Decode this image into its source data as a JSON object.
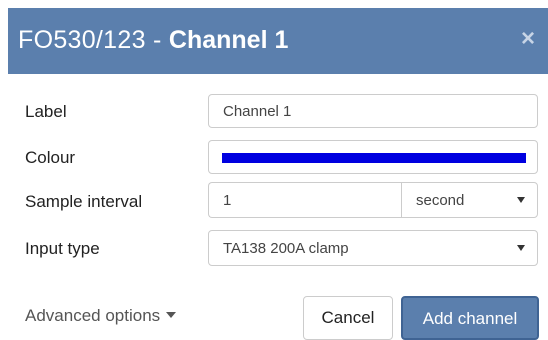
{
  "dialog": {
    "title_code": "FO530/123 - ",
    "title_name": "Channel 1",
    "close_symbol": "×"
  },
  "form": {
    "label": {
      "label": "Label",
      "value": "Channel 1"
    },
    "colour": {
      "label": "Colour",
      "value": "#0000e0"
    },
    "sample_interval": {
      "label": "Sample interval",
      "value": "1",
      "unit": "second"
    },
    "input_type": {
      "label": "Input type",
      "value": "TA138 200A clamp"
    }
  },
  "footer": {
    "advanced_label": "Advanced options",
    "cancel_label": "Cancel",
    "add_label": "Add channel"
  },
  "colors": {
    "header": "#5b7fad",
    "primary_button": "#5b7fad",
    "channel_colour": "#0000e0"
  },
  "icons": {
    "close": "close-icon",
    "dropdown": "chevron-down-icon"
  }
}
